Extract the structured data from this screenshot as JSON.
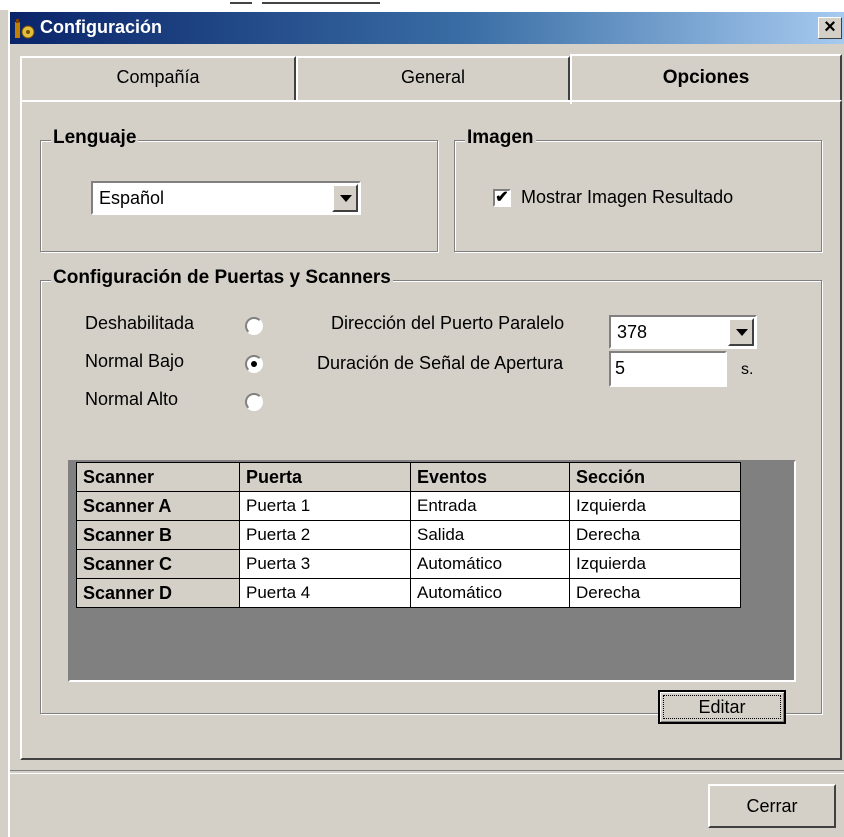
{
  "window": {
    "title": "Configuración",
    "close_glyph": "×"
  },
  "tabs": [
    {
      "label": "Compañía"
    },
    {
      "label": "General"
    },
    {
      "label": "Opciones"
    }
  ],
  "lenguaje": {
    "legend": "Lenguaje",
    "selected": "Español"
  },
  "imagen": {
    "legend": "Imagen",
    "checkbox_label": "Mostrar Imagen Resultado",
    "checked": true,
    "check_glyph": "✔"
  },
  "puertas": {
    "legend": "Configuración de Puertas y Scanners",
    "modes": [
      {
        "label": "Deshabilitada",
        "selected": false
      },
      {
        "label": "Normal Bajo",
        "selected": true
      },
      {
        "label": "Normal Alto",
        "selected": false
      }
    ],
    "port_label": "Dirección del Puerto Paralelo",
    "port_value": "378",
    "signal_label": "Duración de Señal de Apertura",
    "signal_value": "5",
    "signal_unit": "s."
  },
  "table": {
    "headers": [
      "Scanner",
      "Puerta",
      "Eventos",
      "Sección"
    ],
    "rows": [
      [
        "Scanner A",
        "Puerta 1",
        "Entrada",
        "Izquierda"
      ],
      [
        "Scanner B",
        "Puerta 2",
        "Salida",
        "Derecha"
      ],
      [
        "Scanner C",
        "Puerta 3",
        "Automático",
        "Izquierda"
      ],
      [
        "Scanner D",
        "Puerta 4",
        "Automático",
        "Derecha"
      ]
    ]
  },
  "buttons": {
    "edit": "Editar",
    "close": "Cerrar"
  },
  "colors": {
    "titlebar_start": "#0a246a",
    "titlebar_end": "#a6caf0",
    "face": "#d4d0c8",
    "grid_bg": "#808080"
  }
}
